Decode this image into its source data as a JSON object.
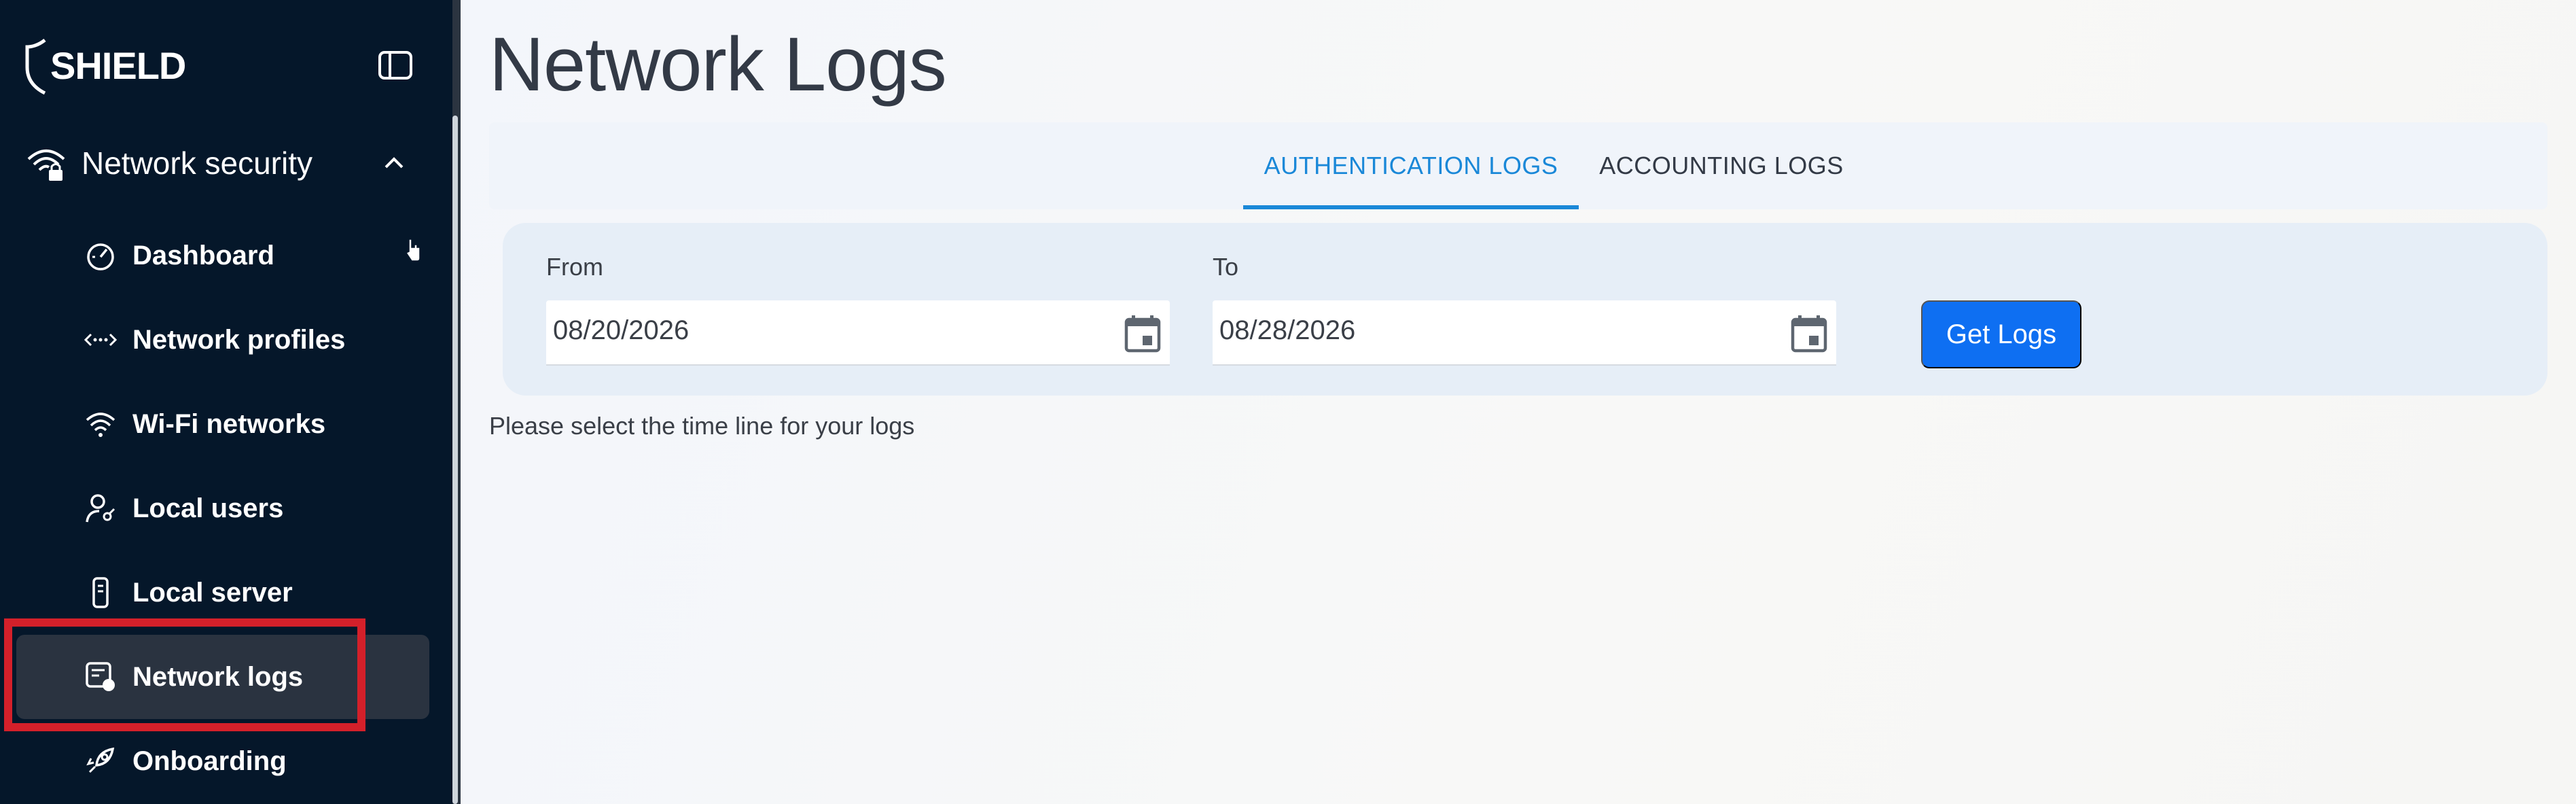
{
  "brand": {
    "name": "SHIELD"
  },
  "sidebar": {
    "section": {
      "label": "Network security",
      "icon": "wifi-lock-icon",
      "expanded": true
    },
    "items": [
      {
        "label": "Dashboard",
        "icon": "gauge-icon"
      },
      {
        "label": "Network profiles",
        "icon": "dots-arrows-icon"
      },
      {
        "label": "Wi-Fi networks",
        "icon": "wifi-icon"
      },
      {
        "label": "Local users",
        "icon": "user-key-icon"
      },
      {
        "label": "Local server",
        "icon": "server-phone-icon"
      },
      {
        "label": "Network logs",
        "icon": "log-report-icon",
        "active": true
      },
      {
        "label": "Onboarding",
        "icon": "rocket-icon"
      }
    ]
  },
  "main": {
    "title": "Network Logs",
    "tabs": [
      {
        "label": "AUTHENTICATION LOGS",
        "active": true
      },
      {
        "label": "ACCOUNTING LOGS",
        "active": false
      }
    ],
    "filters": {
      "from_label": "From",
      "from_value": "08/20/2026",
      "to_label": "To",
      "to_value": "08/28/2026",
      "submit_label": "Get Logs"
    },
    "hint": "Please select the time line for your logs"
  },
  "colors": {
    "sidebar_bg": "#05172a",
    "accent": "#1a88d8",
    "button": "#0e6ff2",
    "highlight": "#d4202a"
  }
}
